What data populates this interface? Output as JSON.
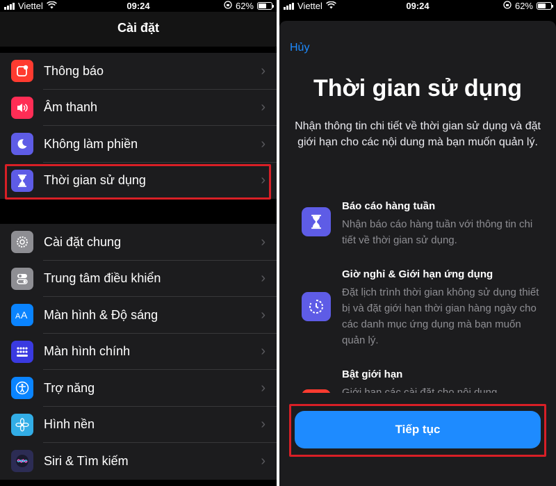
{
  "status": {
    "carrier": "Viettel",
    "time": "09:24",
    "battery": "62%",
    "battery_level": 0.62
  },
  "settings": {
    "title": "Cài đặt",
    "group1": [
      {
        "label": "Thông báo",
        "icon": "notification-icon",
        "color": "#ff3b30"
      },
      {
        "label": "Âm thanh",
        "icon": "speaker-icon",
        "color": "#ff2d55"
      },
      {
        "label": "Không làm phiền",
        "icon": "moon-icon",
        "color": "#5e5ce6"
      },
      {
        "label": "Thời gian sử dụng",
        "icon": "hourglass-icon",
        "color": "#5e5ce6"
      }
    ],
    "group2": [
      {
        "label": "Cài đặt chung",
        "icon": "gear-icon",
        "color": "#8e8e93"
      },
      {
        "label": "Trung tâm điều khiển",
        "icon": "toggles-icon",
        "color": "#8e8e93"
      },
      {
        "label": "Màn hình & Độ sáng",
        "icon": "text-size-icon",
        "color": "#0a84ff"
      },
      {
        "label": "Màn hình chính",
        "icon": "home-grid-icon",
        "color": "#3a3ae0"
      },
      {
        "label": "Trợ năng",
        "icon": "accessibility-icon",
        "color": "#0a84ff"
      },
      {
        "label": "Hình nền",
        "icon": "wallpaper-flower-icon",
        "color": "#32ade6"
      },
      {
        "label": "Siri & Tìm kiếm",
        "icon": "siri-icon",
        "color": "#2c2c54"
      }
    ]
  },
  "screen_time": {
    "cancel": "Hủy",
    "title": "Thời gian sử dụng",
    "intro": "Nhận thông tin chi tiết về thời gian sử dụng và đặt giới hạn cho các nội dung mà bạn muốn quản lý.",
    "features": [
      {
        "title": "Báo cáo hàng tuần",
        "desc": "Nhận báo cáo hàng tuần với thông tin chi tiết về thời gian sử dụng.",
        "icon": "hourglass-icon"
      },
      {
        "title": "Giờ nghỉ & Giới hạn ứng dụng",
        "desc": "Đặt lịch trình thời gian không sử dụng thiết bị và đặt giới hạn thời gian hàng ngày cho các danh mục ứng dụng mà bạn muốn quản lý.",
        "icon": "downtime-clock-icon"
      },
      {
        "title": "Bật giới hạn",
        "desc": "Giới hạn các cài đặt cho nội dung",
        "icon": "restriction-icon"
      }
    ],
    "continue": "Tiếp tục",
    "highlight_color": "#d81f26"
  }
}
